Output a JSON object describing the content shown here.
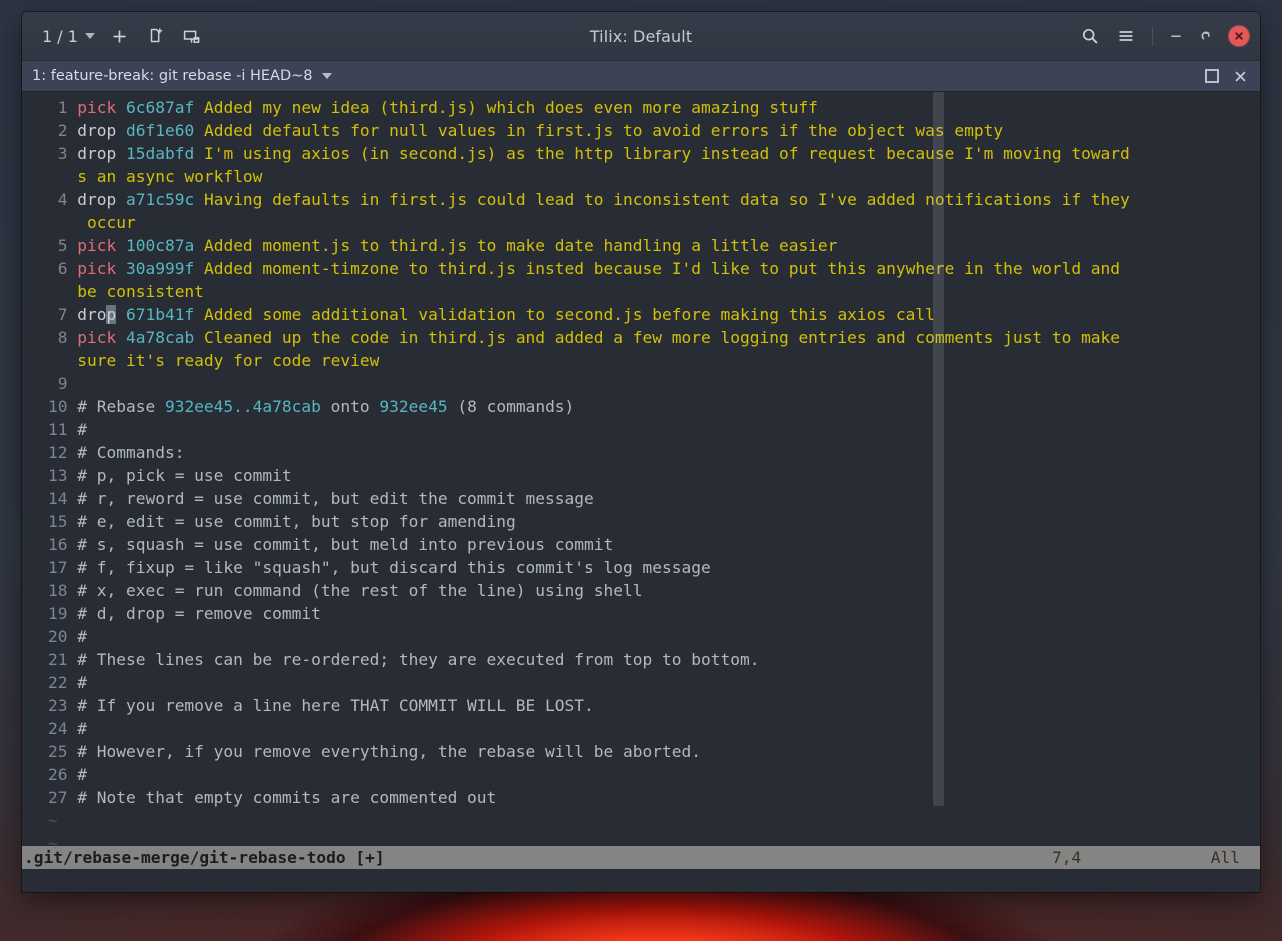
{
  "window": {
    "title": "Tilix: Default",
    "session_count": "1 / 1",
    "header_icons": [
      {
        "name": "session-dropdown-caret",
        "glyph": "▾"
      },
      {
        "name": "new-terminal-plus-icon",
        "glyph": "+"
      },
      {
        "name": "new-session-icon",
        "glyph": "🗋"
      },
      {
        "name": "split-terminal-icon",
        "glyph": "🗖"
      }
    ],
    "right_icons": [
      {
        "name": "search-icon",
        "glyph": "search"
      },
      {
        "name": "hamburger-menu-icon",
        "glyph": "menu"
      },
      {
        "name": "minimize-icon",
        "glyph": "–"
      },
      {
        "name": "restore-icon",
        "glyph": "restore"
      },
      {
        "name": "close-icon",
        "glyph": "✕"
      }
    ]
  },
  "terminal_tab": {
    "title": "1: feature-break: git rebase -i HEAD~8",
    "maximize_label": "□",
    "close_label": "✕"
  },
  "editor": {
    "lines": [
      {
        "num": "1",
        "cmd": "pick",
        "cmd_class": "c-pick",
        "hash": "6c687af",
        "msg": "Added my new idea (third.js) which does even more amazing stuff"
      },
      {
        "num": "2",
        "cmd": "drop",
        "cmd_class": "c-drop",
        "hash": "d6f1e60",
        "msg": "Added defaults for null values in first.js to avoid errors if the object was empty"
      },
      {
        "num": "3",
        "cmd": "drop",
        "cmd_class": "c-drop",
        "hash": "15dabfd",
        "msg": "I'm using axios (in second.js) as the http library instead of request because I'm moving toward",
        "wrap": "s an async workflow"
      },
      {
        "num": "4",
        "cmd": "drop",
        "cmd_class": "c-drop",
        "hash": "a71c59c",
        "msg": "Having defaults in first.js could lead to inconsistent data so I've added notifications if they",
        "wrap": " occur"
      },
      {
        "num": "5",
        "cmd": "pick",
        "cmd_class": "c-pick",
        "hash": "100c87a",
        "msg": "Added moment.js to third.js to make date handling a little easier"
      },
      {
        "num": "6",
        "cmd": "pick",
        "cmd_class": "c-pick",
        "hash": "30a999f",
        "msg": "Added moment-timzone to third.js insted because I'd like to put this anywhere in the world and",
        "wrap": "be consistent"
      },
      {
        "num": "7",
        "cmd": "drop",
        "cmd_class": "c-drop",
        "hash": "671b41f",
        "msg": "Added some additional validation to second.js before making this axios call",
        "cursor_col": 3
      },
      {
        "num": "8",
        "cmd": "pick",
        "cmd_class": "c-pick",
        "hash": "4a78cab",
        "msg": "Cleaned up the code in third.js and added a few more logging entries and comments just to make",
        "wrap": "sure it's ready for code review"
      },
      {
        "num": "9",
        "text": ""
      },
      {
        "num": "10",
        "comment": "# Rebase 932ee45..4a78cab onto 932ee45 (8 commands)",
        "rebase": {
          "prefix": "# Rebase ",
          "hash1": "932ee45..4a78cab",
          "mid": " onto ",
          "hash2": "932ee45",
          "suffix": " (8 commands)"
        }
      },
      {
        "num": "11",
        "comment": "#"
      },
      {
        "num": "12",
        "comment": "# Commands:"
      },
      {
        "num": "13",
        "comment": "# p, pick = use commit"
      },
      {
        "num": "14",
        "comment": "# r, reword = use commit, but edit the commit message"
      },
      {
        "num": "15",
        "comment": "# e, edit = use commit, but stop for amending"
      },
      {
        "num": "16",
        "comment": "# s, squash = use commit, but meld into previous commit"
      },
      {
        "num": "17",
        "comment": "# f, fixup = like \"squash\", but discard this commit's log message"
      },
      {
        "num": "18",
        "comment": "# x, exec = run command (the rest of the line) using shell"
      },
      {
        "num": "19",
        "comment": "# d, drop = remove commit"
      },
      {
        "num": "20",
        "comment": "#"
      },
      {
        "num": "21",
        "comment": "# These lines can be re-ordered; they are executed from top to bottom."
      },
      {
        "num": "22",
        "comment": "#"
      },
      {
        "num": "23",
        "comment": "# If you remove a line here THAT COMMIT WILL BE LOST."
      },
      {
        "num": "24",
        "comment": "#"
      },
      {
        "num": "25",
        "comment": "# However, if you remove everything, the rebase will be aborted."
      },
      {
        "num": "26",
        "comment": "#"
      },
      {
        "num": "27",
        "comment": "# Note that empty commits are commented out"
      }
    ],
    "empty_markers": [
      "~",
      "~"
    ]
  },
  "statusline": {
    "file": ".git/rebase-merge/git-rebase-todo [+]",
    "position": "7,4",
    "scroll": "All"
  }
}
